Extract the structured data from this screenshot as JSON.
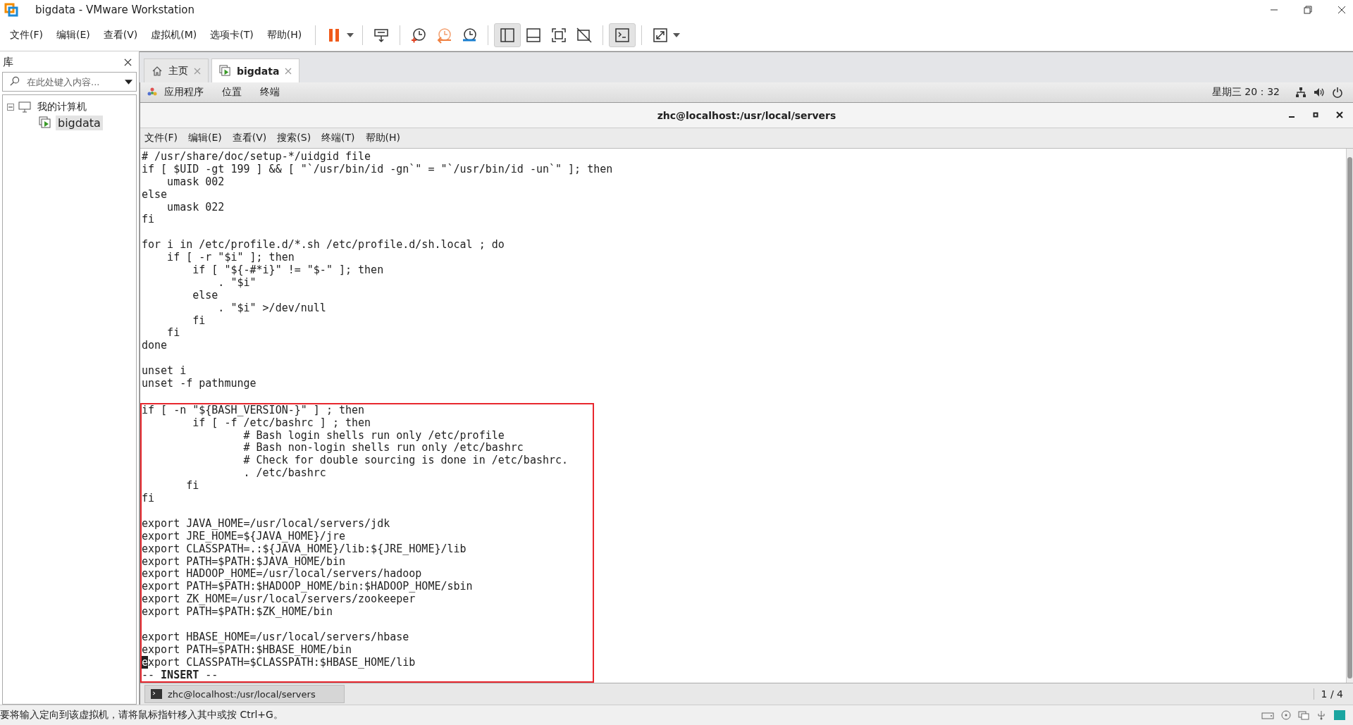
{
  "window": {
    "title": "bigdata - VMware Workstation"
  },
  "menu": [
    "文件(F)",
    "编辑(E)",
    "查看(V)",
    "虚拟机(M)",
    "选项卡(T)",
    "帮助(H)"
  ],
  "library": {
    "title": "库",
    "search": {
      "placeholder": "在此处键入内容..."
    },
    "tree": [
      {
        "label": "我的计算机",
        "expanded": true,
        "selected": false,
        "children": [
          {
            "label": "bigdata",
            "selected": true
          }
        ]
      }
    ]
  },
  "tabs": [
    {
      "label": "主页",
      "kind": "home",
      "selected": false
    },
    {
      "label": "bigdata",
      "kind": "vm",
      "selected": true
    }
  ],
  "guest_bar": {
    "menus": [
      "应用程序",
      "位置",
      "终端"
    ],
    "clock": "星期三 20：32"
  },
  "terminal": {
    "title": "zhc@localhost:/usr/local/servers",
    "menu": [
      "文件(F)",
      "编辑(E)",
      "查看(V)",
      "搜索(S)",
      "终端(T)",
      "帮助(H)"
    ],
    "blocks": [
      {
        "highlighted": false,
        "lines": [
          {
            "text": "# /usr/share/doc/setup-*/uidgid file",
            "cursor": false
          },
          {
            "text": "if [ $UID -gt 199 ] && [ \"`/usr/bin/id -gn`\" = \"`/usr/bin/id -un`\" ]; then",
            "cursor": false
          },
          {
            "text": "    umask 002",
            "cursor": false
          },
          {
            "text": "else",
            "cursor": false
          },
          {
            "text": "    umask 022",
            "cursor": false
          },
          {
            "text": "fi",
            "cursor": false
          }
        ]
      },
      {
        "highlighted": false,
        "lines": [
          {
            "text": "for i in /etc/profile.d/*.sh /etc/profile.d/sh.local ; do",
            "cursor": false
          },
          {
            "text": "    if [ -r \"$i\" ]; then",
            "cursor": false
          },
          {
            "text": "        if [ \"${-#*i}\" != \"$-\" ]; then",
            "cursor": false
          },
          {
            "text": "            . \"$i\"",
            "cursor": false
          },
          {
            "text": "        else",
            "cursor": false
          },
          {
            "text": "            . \"$i\" >/dev/null",
            "cursor": false
          },
          {
            "text": "        fi",
            "cursor": false
          },
          {
            "text": "    fi",
            "cursor": false
          },
          {
            "text": "done",
            "cursor": false
          }
        ]
      },
      {
        "highlighted": false,
        "lines": [
          {
            "text": "unset i",
            "cursor": false
          },
          {
            "text": "unset -f pathmunge",
            "cursor": false
          }
        ]
      },
      {
        "highlighted": true,
        "lines": [
          {
            "text": "if [ -n \"${BASH_VERSION-}\" ] ; then",
            "cursor": false
          },
          {
            "text": "        if [ -f /etc/bashrc ] ; then",
            "cursor": false
          },
          {
            "text": "                # Bash login shells run only /etc/profile",
            "cursor": false
          },
          {
            "text": "                # Bash non-login shells run only /etc/bashrc",
            "cursor": false
          },
          {
            "text": "                # Check for double sourcing is done in /etc/bashrc.",
            "cursor": false
          },
          {
            "text": "                . /etc/bashrc",
            "cursor": false
          },
          {
            "text": "       fi",
            "cursor": false
          },
          {
            "text": "fi",
            "cursor": false
          }
        ]
      },
      {
        "highlighted": true,
        "lines": [
          {
            "text": "export JAVA_HOME=/usr/local/servers/jdk",
            "cursor": false
          },
          {
            "text": "export JRE_HOME=${JAVA_HOME}/jre",
            "cursor": false
          },
          {
            "text": "export CLASSPATH=.:${JAVA_HOME}/lib:${JRE_HOME}/lib",
            "cursor": false
          },
          {
            "text": "export PATH=$PATH:$JAVA_HOME/bin",
            "cursor": false
          },
          {
            "text": "export HADOOP_HOME=/usr/local/servers/hadoop",
            "cursor": false
          },
          {
            "text": "export PATH=$PATH:$HADOOP_HOME/bin:$HADOOP_HOME/sbin",
            "cursor": false
          },
          {
            "text": "export ZK_HOME=/usr/local/servers/zookeeper",
            "cursor": false
          },
          {
            "text": "export PATH=$PATH:$ZK_HOME/bin",
            "cursor": false
          }
        ]
      },
      {
        "highlighted": true,
        "lines": [
          {
            "text": "export HBASE_HOME=/usr/local/servers/hbase",
            "cursor": false
          },
          {
            "text": "export PATH=$PATH:$HBASE_HOME/bin",
            "cursor": false
          },
          {
            "text": "export CLASSPATH=$CLASSPATH:$HBASE_HOME/lib",
            "cursor": true
          }
        ]
      }
    ],
    "mode_line": "-- **INSERT** --"
  },
  "taskbar": {
    "task": "zhc@localhost:/usr/local/servers",
    "workspace": "1 / 4"
  },
  "status_bar": {
    "message": "要将输入定向到该虚拟机，请将鼠标指针移入其中或按 Ctrl+G。"
  }
}
